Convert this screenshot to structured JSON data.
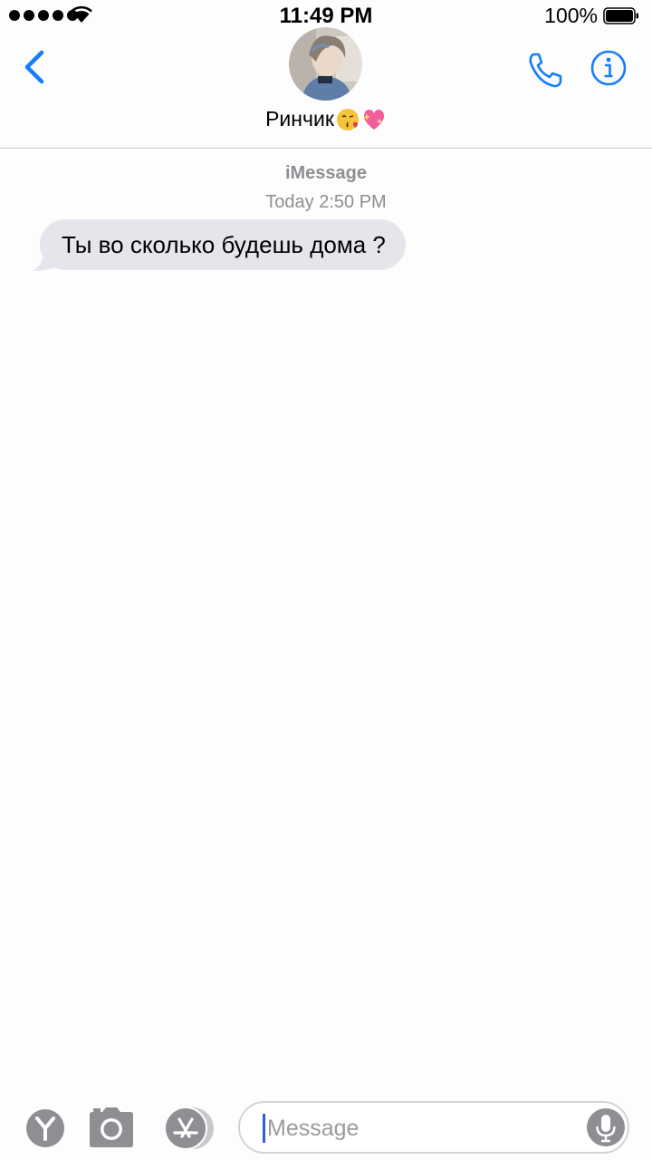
{
  "status_bar": {
    "time": "11:49 PM",
    "battery_percent": "100%",
    "signal_bars": 5
  },
  "header": {
    "back_icon": "chevron-left-icon",
    "contact_name": "Ринчик",
    "name_emojis": [
      "kissing-face-heart-emoji",
      "sparkling-heart-emoji"
    ],
    "call_icon": "phone-icon",
    "info_icon": "info-icon"
  },
  "conversation": {
    "service": "iMessage",
    "timestamp": "Today 2:50 PM",
    "messages": [
      {
        "direction": "incoming",
        "text": "Ты во сколько будешь дома ?"
      }
    ]
  },
  "input_bar": {
    "digital_touch_icon": "digital-touch-icon",
    "camera_icon": "camera-icon",
    "appstore_icon": "appstore-icon",
    "placeholder": "Message",
    "mic_icon": "microphone-icon"
  },
  "colors": {
    "accent": "#147efb",
    "incoming_bubble": "#e6e5eb",
    "secondary_text": "#8e8e93",
    "toolbar_icon": "#8e8e93"
  }
}
